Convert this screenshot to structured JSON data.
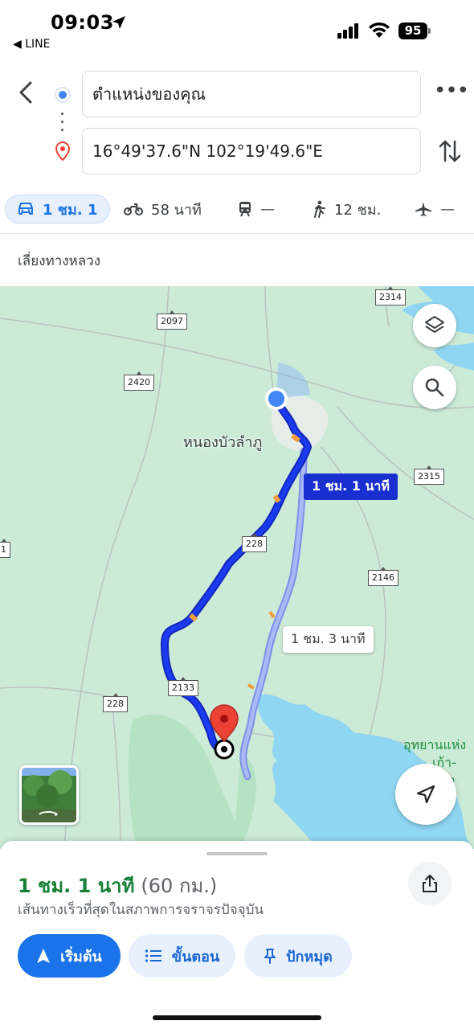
{
  "status_bar": {
    "time": "09:03",
    "back_app": "◀ LINE",
    "battery": "95"
  },
  "directions": {
    "origin": "ตำแหน่งของคุณ",
    "destination": "16°49'37.6\"N 102°19'49.6\"E"
  },
  "modes": [
    {
      "name": "drive",
      "label": "1 ชม. 1",
      "icon": "car-icon",
      "active": true
    },
    {
      "name": "motorcycle",
      "label": "58 นาที",
      "icon": "motorcycle-icon"
    },
    {
      "name": "transit",
      "label": "—",
      "icon": "train-icon"
    },
    {
      "name": "walk",
      "label": "12 ชม.",
      "icon": "walk-icon"
    },
    {
      "name": "flight",
      "label": "—",
      "icon": "plane-icon"
    }
  ],
  "options": {
    "avoid_label": "เลี่ยงทางหลวง"
  },
  "map": {
    "town_label": "หนองบัวลำภู",
    "park_label_line1": "อุทยานแห่ง",
    "park_label_line2": "เก้า-",
    "park_label_line3": "ง่ค",
    "shields": [
      "2314",
      "2097",
      "2420",
      "2315",
      "228",
      "2146",
      "2133",
      "228",
      "1"
    ],
    "route_main_label": "1 ชม. 1 นาที",
    "route_alt_label": "1 ชม. 3 นาที",
    "route_color_main": "#1a3bf0",
    "route_color_alt": "#9fb0f5"
  },
  "sheet": {
    "duration": "1 ชม. 1 นาที",
    "distance": "(60 กม.)",
    "description": "เส้นทางเร็วที่สุดในสภาพการจราจรปัจจุบัน",
    "start_label": "เริ่มต้น",
    "steps_label": "ขั้นตอน",
    "pin_label": "ปักหมุด"
  }
}
